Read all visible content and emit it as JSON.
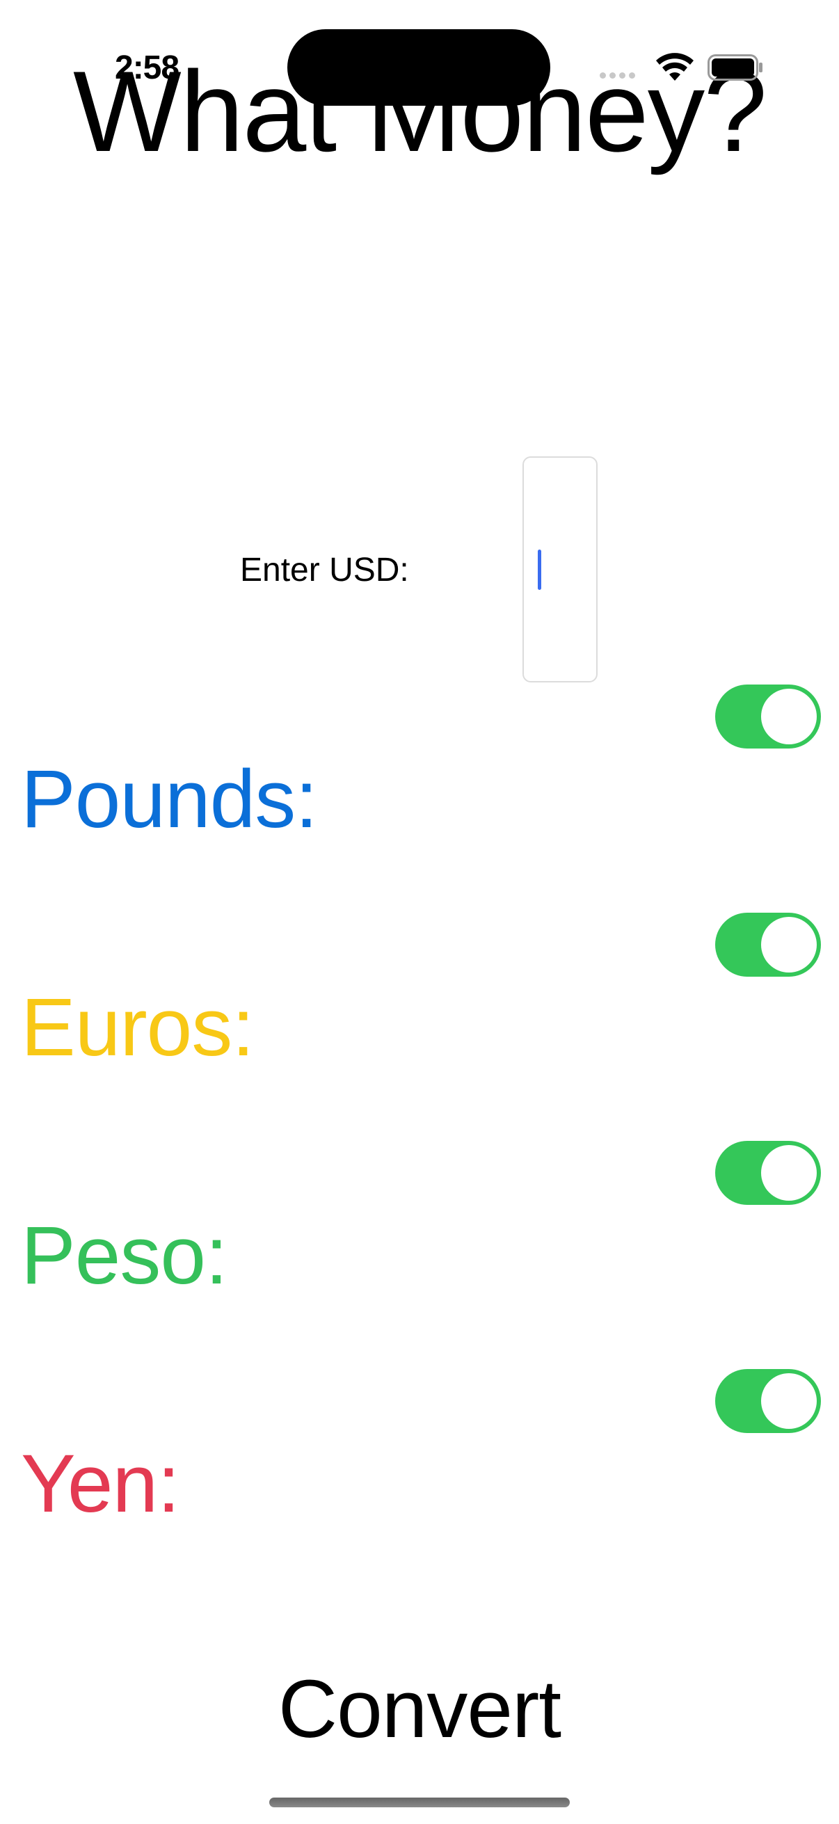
{
  "status_bar": {
    "time": "2:58",
    "icons": [
      "signal-icon",
      "wifi-icon",
      "battery-icon"
    ]
  },
  "app": {
    "title": "What Money?"
  },
  "input": {
    "label": "Enter USD:",
    "value": "",
    "focused": true
  },
  "currencies": [
    {
      "label": "Pounds:",
      "color": "#0b6fd8",
      "enabled": true
    },
    {
      "label": "Euros:",
      "color": "#f8c816",
      "enabled": true
    },
    {
      "label": "Peso:",
      "color": "#35c05a",
      "enabled": true
    },
    {
      "label": "Yen:",
      "color": "#e33a52",
      "enabled": true
    }
  ],
  "actions": {
    "convert_label": "Convert"
  },
  "colors": {
    "toggle_on": "#34c759",
    "caret": "#3a6cf0"
  }
}
